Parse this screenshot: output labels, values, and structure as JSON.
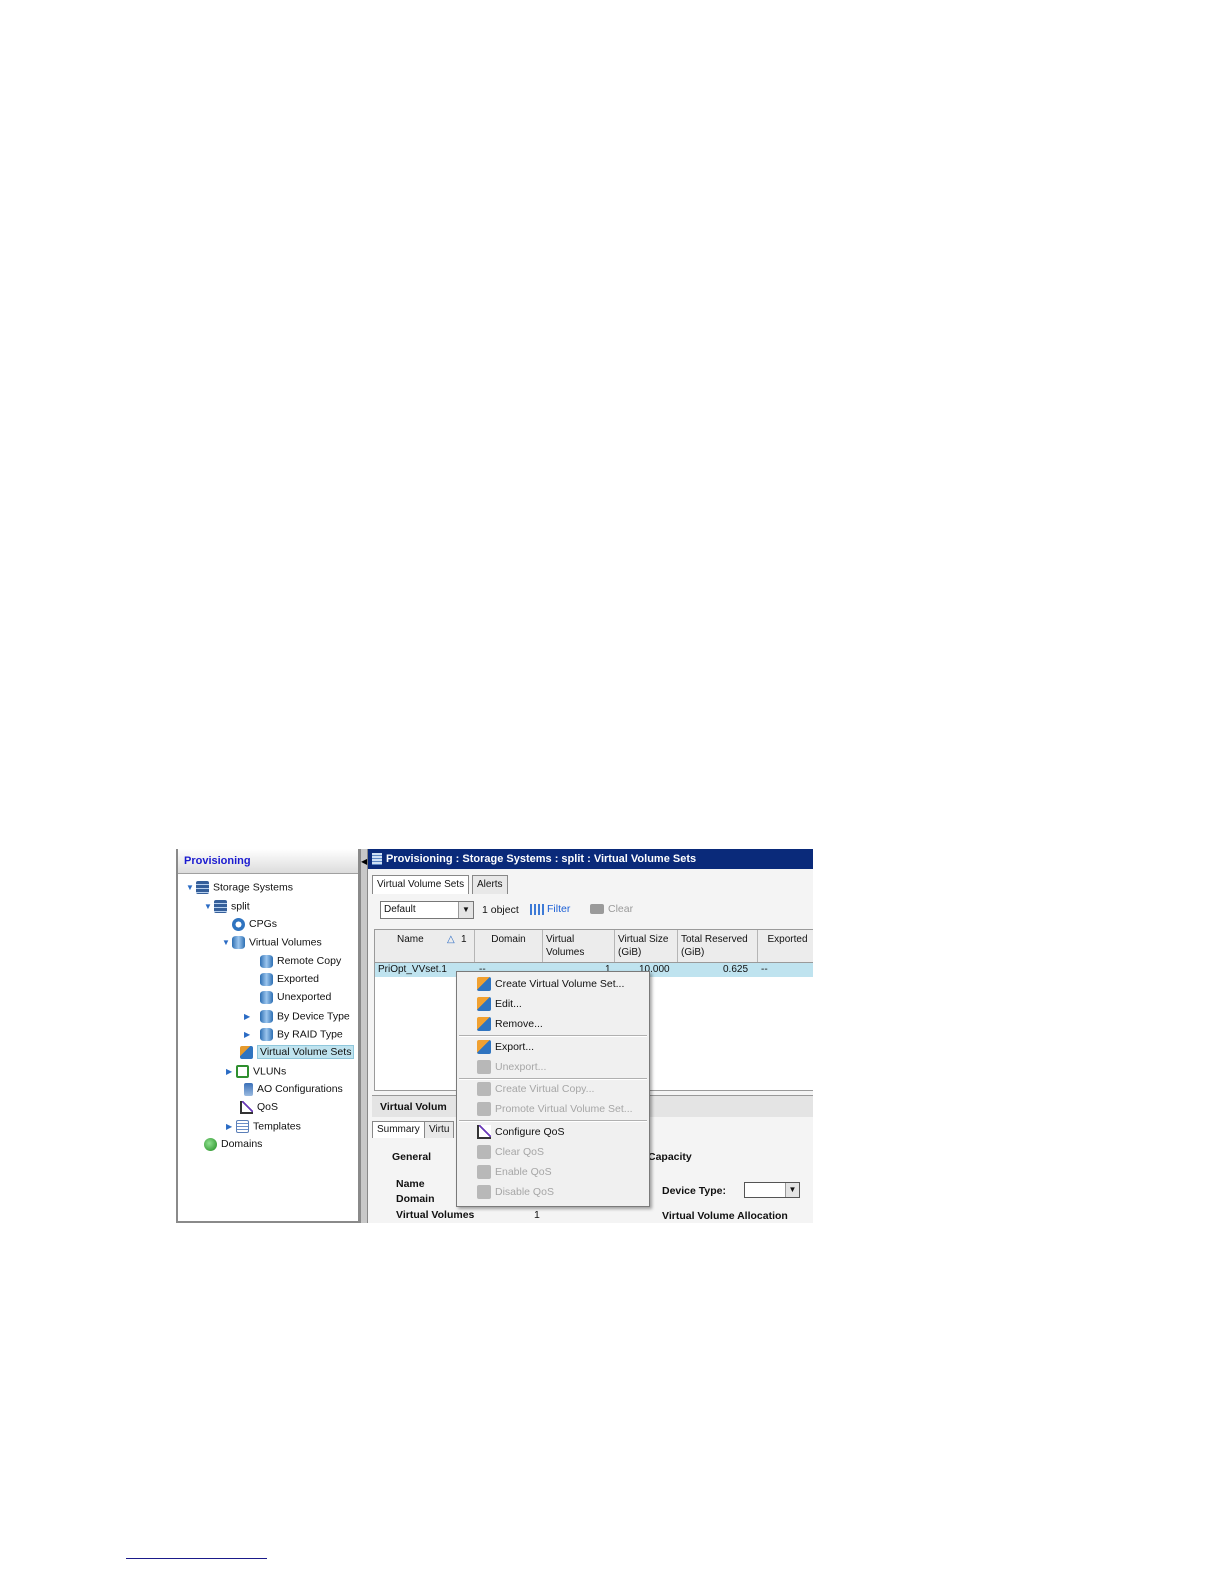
{
  "nav": {
    "title": "Provisioning",
    "tree": [
      {
        "label": "Storage Systems",
        "expanded": true,
        "icon": "storage-icon"
      },
      {
        "label": "split",
        "expanded": true,
        "icon": "server-icon"
      },
      {
        "label": "CPGs",
        "icon": "cpg-icon"
      },
      {
        "label": "Virtual Volumes",
        "expanded": true,
        "icon": "volume-icon"
      },
      {
        "label": "Remote Copy",
        "icon": "volume-icon"
      },
      {
        "label": "Exported",
        "icon": "volume-icon"
      },
      {
        "label": "Unexported",
        "icon": "volume-icon"
      },
      {
        "label": "By Device Type",
        "expanded": false,
        "icon": "volume-icon"
      },
      {
        "label": "By RAID Type",
        "expanded": false,
        "icon": "volume-icon"
      },
      {
        "label": "Virtual Volume Sets",
        "selected": true,
        "icon": "volume-set-icon"
      },
      {
        "label": "VLUNs",
        "expanded": false,
        "icon": "vlun-icon"
      },
      {
        "label": "AO Configurations",
        "icon": "ao-icon"
      },
      {
        "label": "QoS",
        "icon": "qos-icon"
      },
      {
        "label": "Templates",
        "expanded": false,
        "icon": "template-icon"
      },
      {
        "label": "Domains",
        "icon": "domain-icon"
      }
    ]
  },
  "main": {
    "title": "Provisioning : Storage Systems : split : Virtual Volume Sets",
    "tabs": [
      "Virtual Volume Sets",
      "Alerts"
    ],
    "toolbar": {
      "view": "Default",
      "count": "1 object",
      "filter": "Filter",
      "clear": "Clear"
    },
    "table": {
      "columns": [
        "Name",
        "Domain",
        "Virtual Volumes",
        "Virtual Size (GiB)",
        "Total Reserved (GiB)",
        "Exported"
      ],
      "sort_indicator": "1",
      "rows": [
        {
          "name": "PriOpt_VVset.1",
          "domain": "--",
          "virtual_volumes": "1",
          "virtual_size": "10.000",
          "total_reserved": "0.625",
          "exported": "--"
        }
      ]
    },
    "detail": {
      "title": "Virtual Volum",
      "tabs": [
        "Summary",
        "Virtu"
      ],
      "general_heading": "General",
      "capacity_heading": "Capacity",
      "labels": {
        "name": "Name",
        "domain": "Domain",
        "virtual_volumes": "Virtual Volumes"
      },
      "values": {
        "virtual_volumes": "1"
      },
      "device_type_label": "Device Type:",
      "allocation_label": "Virtual Volume Allocation"
    }
  },
  "context_menu": {
    "items": [
      {
        "label": "Create Virtual Volume Set...",
        "enabled": true
      },
      {
        "label": "Edit...",
        "enabled": true
      },
      {
        "label": "Remove...",
        "enabled": true
      },
      {
        "label": "Export...",
        "enabled": true
      },
      {
        "label": "Unexport...",
        "enabled": false
      },
      {
        "label": "Create Virtual Copy...",
        "enabled": false
      },
      {
        "label": "Promote Virtual Volume Set...",
        "enabled": false
      },
      {
        "label": "Configure QoS",
        "enabled": true
      },
      {
        "label": "Clear QoS",
        "enabled": false
      },
      {
        "label": "Enable QoS",
        "enabled": false
      },
      {
        "label": "Disable QoS",
        "enabled": false
      }
    ]
  },
  "colors": {
    "title_bar": "#0a2a7a",
    "nav_title": "#1a1ad0",
    "selection": "#bfe3ef",
    "filter_link": "#1b5fd6",
    "disabled_text": "#a6a6a6"
  }
}
